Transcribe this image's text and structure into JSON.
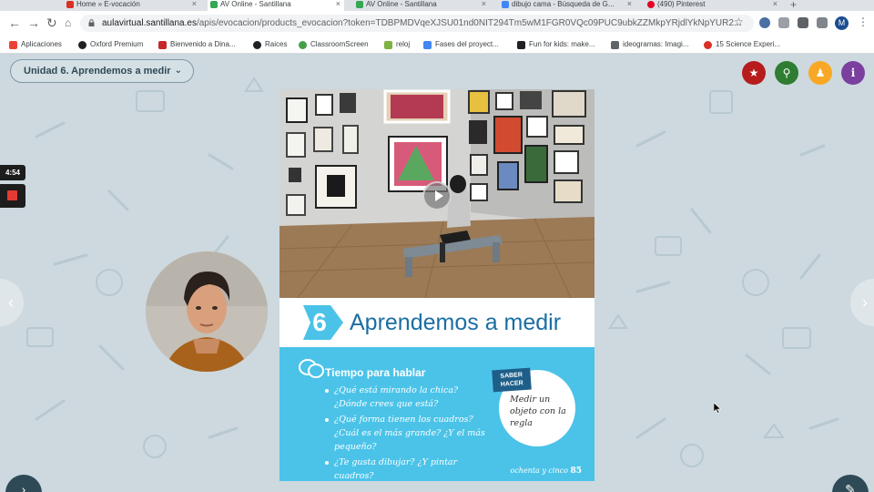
{
  "browser": {
    "tabs": [
      {
        "title": "Home » E-vocación",
        "color": "#d93025"
      },
      {
        "title": "AV Online - Santillana",
        "color": "#34a853"
      },
      {
        "title": "AV Online - Santillana",
        "color": "#34a853"
      },
      {
        "title": "dibujo cama - Búsqueda de G...",
        "color": "#4285f4"
      },
      {
        "title": "(490) Pinterest",
        "color": "#e60023"
      }
    ],
    "new_tab": "+",
    "url_host": "aulavirtual.santillana.es",
    "url_path": "/apis/evocacion/products_evocacion?token=TDBPMDVqeXJSU01nd0NIT294Tm5wM1FGR0VQc09PUC9ubkZZMkpYRjdlYkNpYUR2...",
    "profile_initial": "M",
    "bookmarks": [
      {
        "label": "Aplicaciones",
        "color": "#ea4335"
      },
      {
        "label": "Oxford Premium",
        "color": "#202124"
      },
      {
        "label": "Bienvenido a Dina...",
        "color": "#c62828"
      },
      {
        "label": "Raices",
        "color": "#202124"
      },
      {
        "label": "ClassroomScreen",
        "color": "#43a047"
      },
      {
        "label": "reloj",
        "color": "#7cb342"
      },
      {
        "label": "Fases del proyect...",
        "color": "#4285f4"
      },
      {
        "label": "Fun for kids: make...",
        "color": "#202124"
      },
      {
        "label": "ideogramas: Imagi...",
        "color": "#5f6368"
      },
      {
        "label": "15 Science Experi...",
        "color": "#d93025"
      }
    ]
  },
  "app": {
    "unit_selector": "Unidad 6. Aprendemos a medir",
    "timer": "4:54",
    "buttons": [
      {
        "name": "favorites-button",
        "icon": "★",
        "color": "#b71c1c"
      },
      {
        "name": "search-button",
        "icon": "⚲",
        "color": "#2e7d32"
      },
      {
        "name": "accessibility-button",
        "icon": "♟",
        "color": "#f9a825"
      },
      {
        "name": "info-button",
        "icon": "i",
        "color": "#7b3fa0"
      }
    ]
  },
  "book": {
    "unit_number": "6",
    "unit_title": "Aprendemos a medir",
    "section_title": "Tiempo para hablar",
    "questions": [
      "¿Qué está mirando la chica? ¿Dónde crees que está?",
      "¿Qué forma tienen los cuadros? ¿Cuál es el más grande? ¿Y el más pequeño?",
      "¿Te gusta dibujar? ¿Y pintar cuadros?"
    ],
    "saber_hacer_tag": "SABER HACER",
    "saber_hacer_text": "Medir un objeto con la regla",
    "page_words": "ochenta y cinco",
    "page_number": "85"
  }
}
